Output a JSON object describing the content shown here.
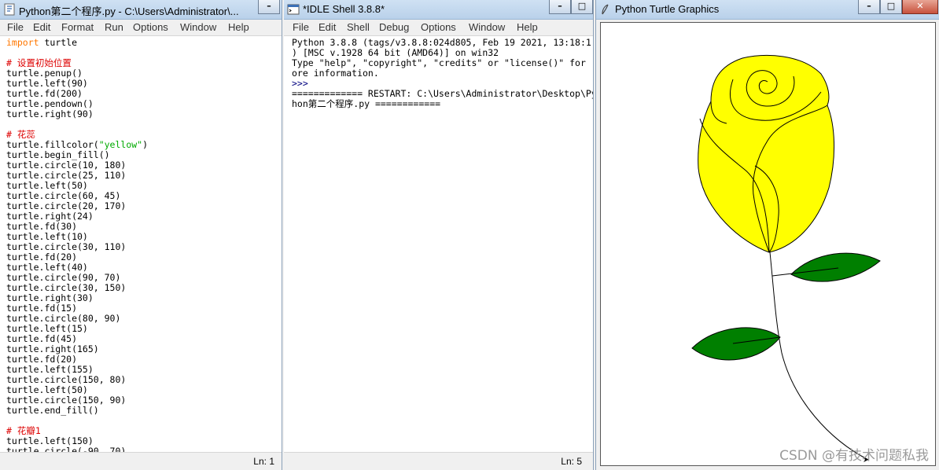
{
  "editor_window": {
    "title": "Python第二个程序.py - C:\\Users\\Administrator\\...",
    "menu": [
      "File",
      "Edit",
      "Format",
      "Run",
      "Options",
      "Window",
      "Help"
    ],
    "lines": [
      {
        "text": "import turtle",
        "kind": "import"
      },
      {
        "text": "",
        "kind": "code"
      },
      {
        "text": "# 设置初始位置",
        "kind": "comment"
      },
      {
        "text": "turtle.penup()",
        "kind": "code"
      },
      {
        "text": "turtle.left(90)",
        "kind": "code"
      },
      {
        "text": "turtle.fd(200)",
        "kind": "code"
      },
      {
        "text": "turtle.pendown()",
        "kind": "code"
      },
      {
        "text": "turtle.right(90)",
        "kind": "code"
      },
      {
        "text": "",
        "kind": "code"
      },
      {
        "text": "# 花蕊",
        "kind": "comment"
      },
      {
        "text": "turtle.fillcolor(\"yellow\")",
        "kind": "fillcolor"
      },
      {
        "text": "turtle.begin_fill()",
        "kind": "code"
      },
      {
        "text": "turtle.circle(10, 180)",
        "kind": "code"
      },
      {
        "text": "turtle.circle(25, 110)",
        "kind": "code"
      },
      {
        "text": "turtle.left(50)",
        "kind": "code"
      },
      {
        "text": "turtle.circle(60, 45)",
        "kind": "code"
      },
      {
        "text": "turtle.circle(20, 170)",
        "kind": "code"
      },
      {
        "text": "turtle.right(24)",
        "kind": "code"
      },
      {
        "text": "turtle.fd(30)",
        "kind": "code"
      },
      {
        "text": "turtle.left(10)",
        "kind": "code"
      },
      {
        "text": "turtle.circle(30, 110)",
        "kind": "code"
      },
      {
        "text": "turtle.fd(20)",
        "kind": "code"
      },
      {
        "text": "turtle.left(40)",
        "kind": "code"
      },
      {
        "text": "turtle.circle(90, 70)",
        "kind": "code"
      },
      {
        "text": "turtle.circle(30, 150)",
        "kind": "code"
      },
      {
        "text": "turtle.right(30)",
        "kind": "code"
      },
      {
        "text": "turtle.fd(15)",
        "kind": "code"
      },
      {
        "text": "turtle.circle(80, 90)",
        "kind": "code"
      },
      {
        "text": "turtle.left(15)",
        "kind": "code"
      },
      {
        "text": "turtle.fd(45)",
        "kind": "code"
      },
      {
        "text": "turtle.right(165)",
        "kind": "code"
      },
      {
        "text": "turtle.fd(20)",
        "kind": "code"
      },
      {
        "text": "turtle.left(155)",
        "kind": "code"
      },
      {
        "text": "turtle.circle(150, 80)",
        "kind": "code"
      },
      {
        "text": "turtle.left(50)",
        "kind": "code"
      },
      {
        "text": "turtle.circle(150, 90)",
        "kind": "code"
      },
      {
        "text": "turtle.end_fill()",
        "kind": "code"
      },
      {
        "text": "",
        "kind": "code"
      },
      {
        "text": "# 花瓣1",
        "kind": "comment"
      },
      {
        "text": "turtle.left(150)",
        "kind": "code"
      },
      {
        "text": "turtle.circle(-90, 70)",
        "kind": "code"
      }
    ],
    "status": "Ln: 1"
  },
  "shell_window": {
    "title": "*IDLE Shell 3.8.8*",
    "menu": [
      "File",
      "Edit",
      "Shell",
      "Debug",
      "Options",
      "Window",
      "Help"
    ],
    "lines": [
      "Python 3.8.8 (tags/v3.8.8:024d805, Feb 19 2021, 13:18:1",
      ") [MSC v.1928 64 bit (AMD64)] on win32",
      "Type \"help\", \"copyright\", \"credits\" or \"license()\" for",
      "ore information.",
      ">>> ",
      "============= RESTART: C:\\Users\\Administrator\\Desktop\\Py",
      "hon第二个程序.py ============"
    ],
    "status": "Ln: 5"
  },
  "turtle_window": {
    "title": "Python Turtle Graphics",
    "flower_color": "#ffff00",
    "leaf_color": "#007f00"
  },
  "watermark": "CSDN @有技术问题私我"
}
